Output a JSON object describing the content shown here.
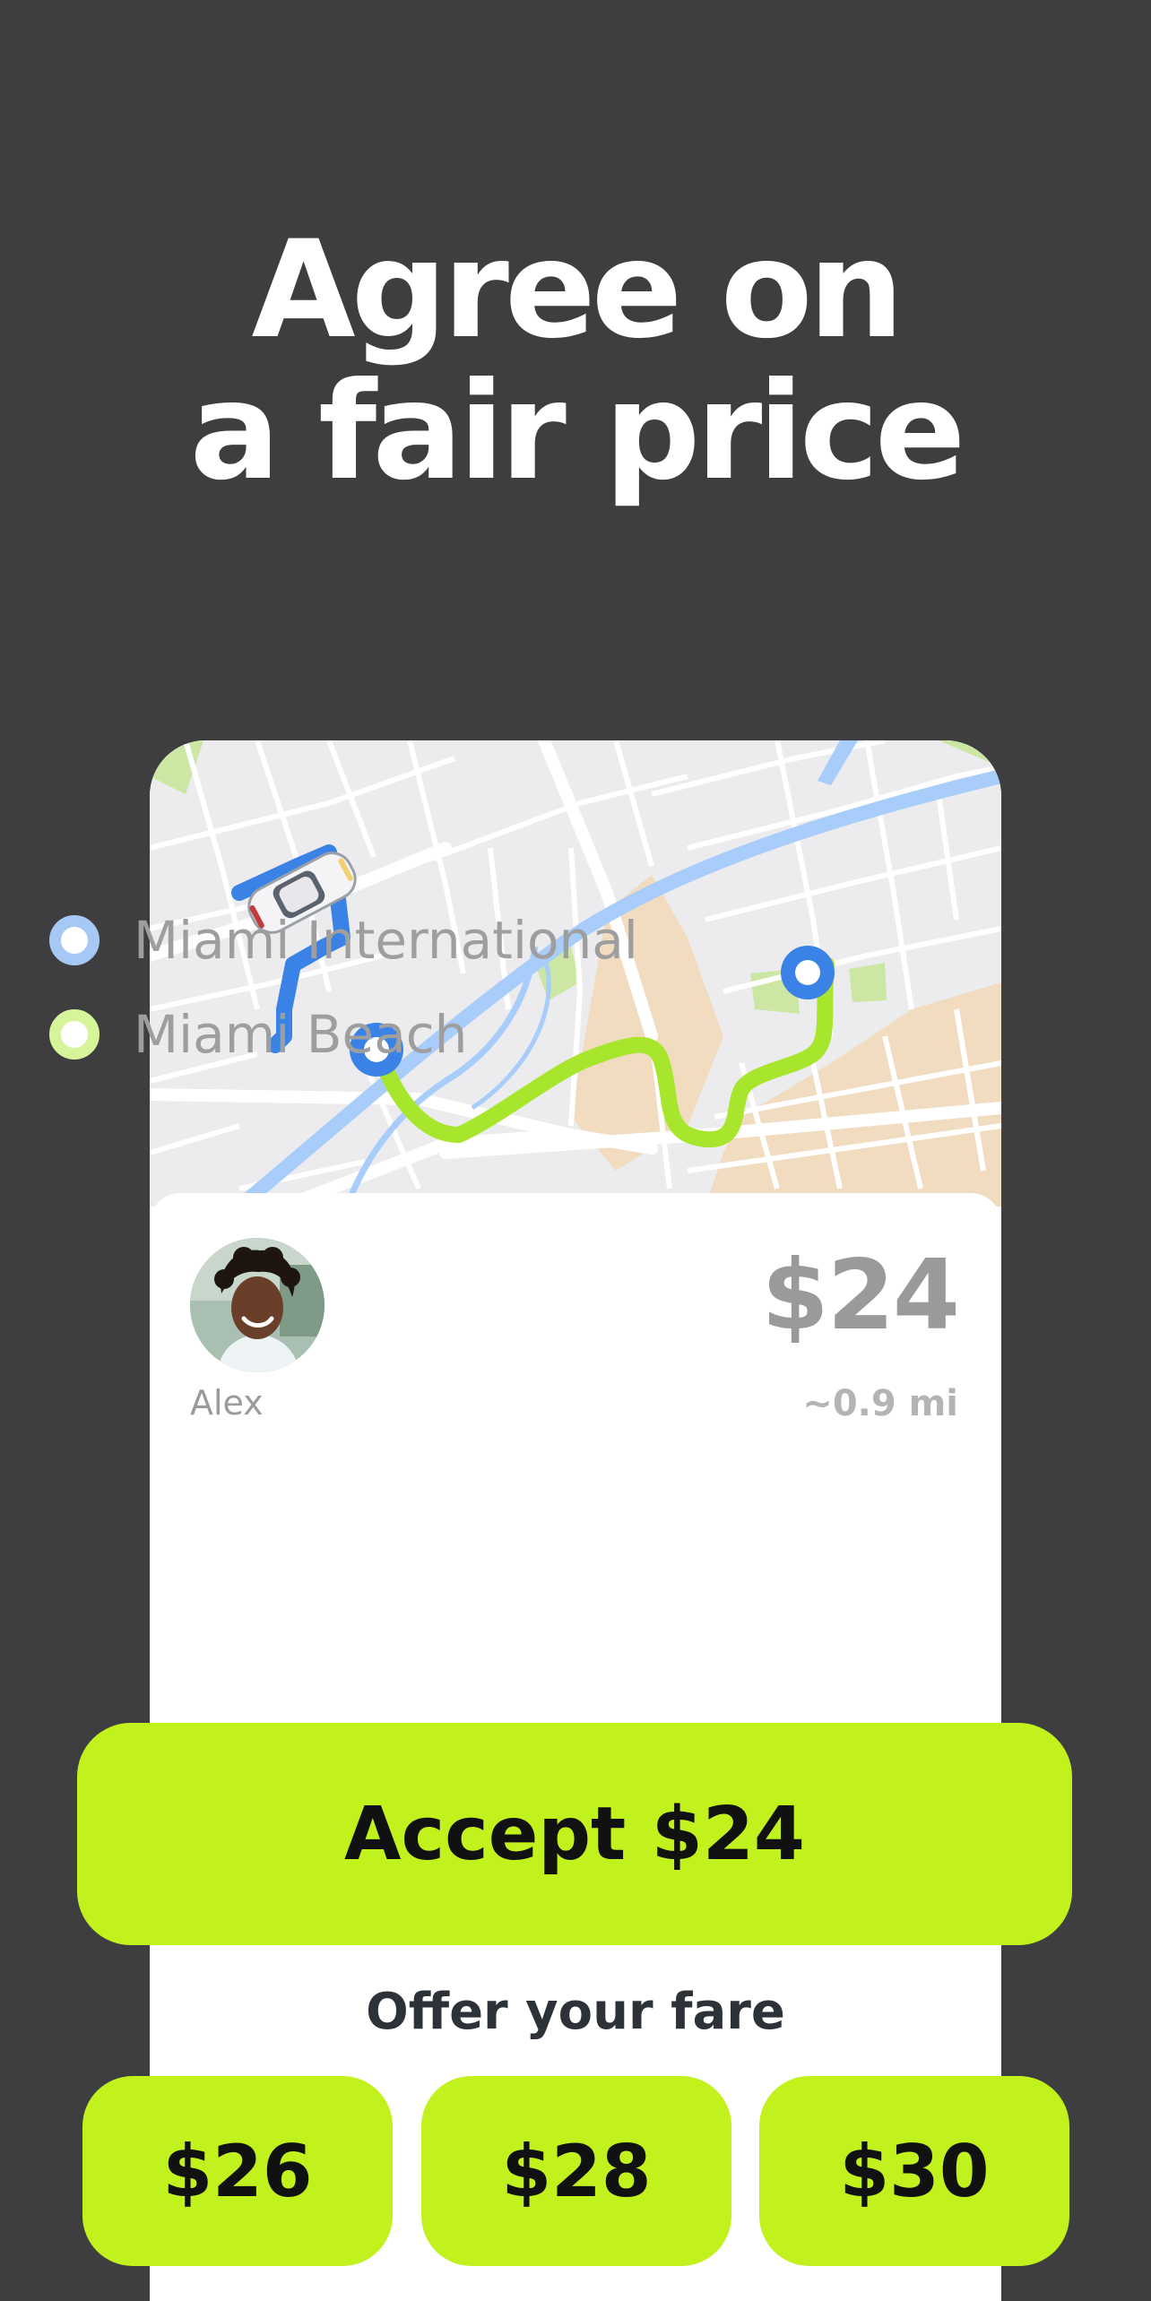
{
  "headline": {
    "line1": "Agree on",
    "line2": "a fair price"
  },
  "map": {
    "route_driver_color": "#3b82e6",
    "route_trip_color": "#a8e62e",
    "water_color": "#a9cdfb",
    "park_color": "#cce6a3"
  },
  "ride": {
    "driver_name": "Alex",
    "price": "$24",
    "distance": "~0.9 mi",
    "origin": "Miami International",
    "destination": "Miami Beach",
    "origin_color": "#a6c8f4",
    "destination_color": "#d6f49a"
  },
  "actions": {
    "accept_label": "Accept $24",
    "offer_title": "Offer your fare",
    "fares": [
      "$26",
      "$28",
      "$30"
    ],
    "accent_color": "#c2f21d"
  }
}
